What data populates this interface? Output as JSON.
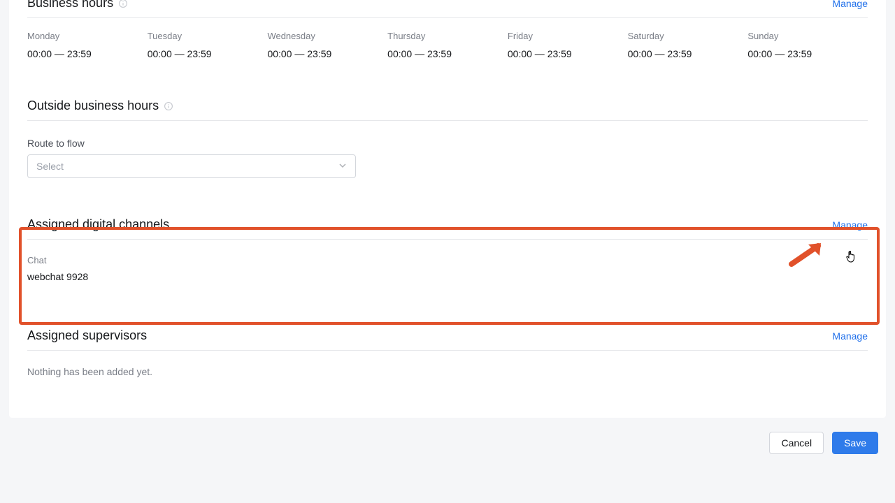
{
  "business_hours": {
    "title": "Business hours",
    "manage": "Manage",
    "days": [
      {
        "label": "Monday",
        "range": "00:00 — 23:59"
      },
      {
        "label": "Tuesday",
        "range": "00:00 — 23:59"
      },
      {
        "label": "Wednesday",
        "range": "00:00 — 23:59"
      },
      {
        "label": "Thursday",
        "range": "00:00 — 23:59"
      },
      {
        "label": "Friday",
        "range": "00:00 — 23:59"
      },
      {
        "label": "Saturday",
        "range": "00:00 — 23:59"
      },
      {
        "label": "Sunday",
        "range": "00:00 — 23:59"
      }
    ]
  },
  "outside_hours": {
    "title": "Outside business hours",
    "route_label": "Route to flow",
    "select_placeholder": "Select"
  },
  "channels": {
    "title": "Assigned digital channels",
    "manage": "Manage",
    "chat_label": "Chat",
    "chat_value": "webchat 9928"
  },
  "supervisors": {
    "title": "Assigned supervisors",
    "manage": "Manage",
    "empty": "Nothing has been added yet."
  },
  "footer": {
    "cancel": "Cancel",
    "save": "Save"
  },
  "annotation": {
    "highlight_color": "#e1512a"
  }
}
